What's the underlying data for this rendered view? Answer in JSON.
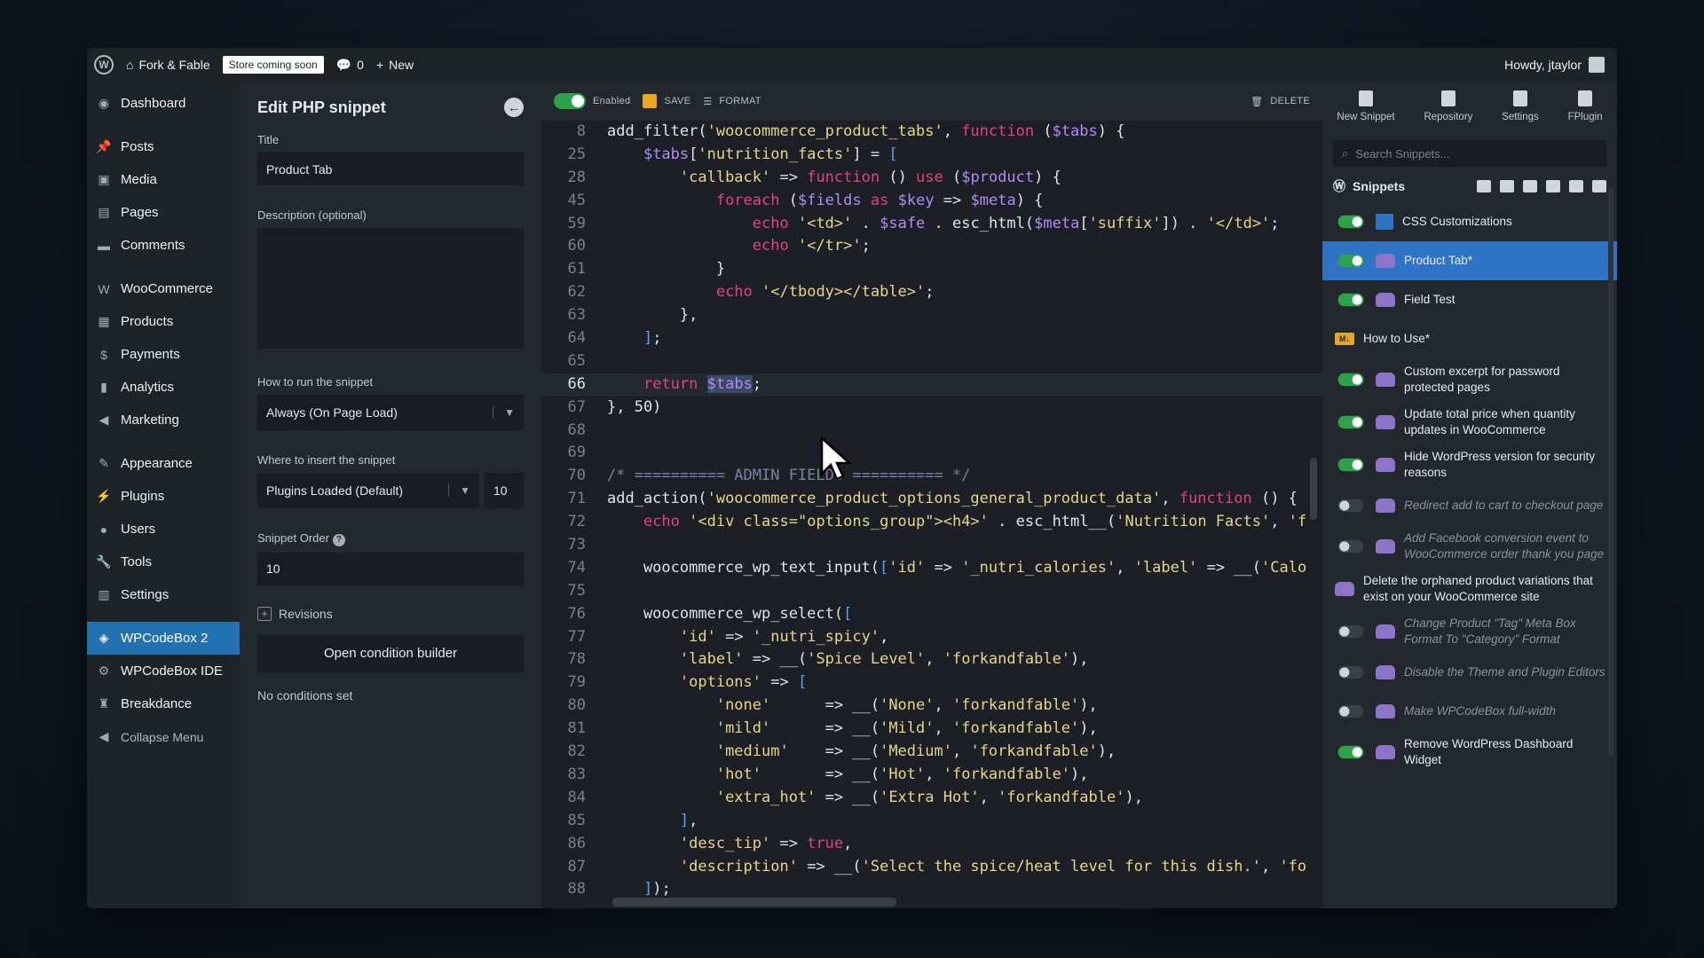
{
  "adminbar": {
    "site_name": "Fork & Fable",
    "store_badge": "Store coming soon",
    "comments_count": "0",
    "new_label": "New",
    "howdy": "Howdy, jtaylor"
  },
  "sidebar": {
    "items": [
      {
        "label": "Dashboard",
        "icon": "dashboard-icon"
      },
      {
        "label": "Posts",
        "icon": "pin-icon"
      },
      {
        "label": "Media",
        "icon": "media-icon"
      },
      {
        "label": "Pages",
        "icon": "pages-icon"
      },
      {
        "label": "Comments",
        "icon": "comment-icon"
      },
      {
        "label": "WooCommerce",
        "icon": "woo-icon"
      },
      {
        "label": "Products",
        "icon": "products-icon"
      },
      {
        "label": "Payments",
        "icon": "payments-icon"
      },
      {
        "label": "Analytics",
        "icon": "analytics-icon"
      },
      {
        "label": "Marketing",
        "icon": "megaphone-icon"
      },
      {
        "label": "Appearance",
        "icon": "brush-icon"
      },
      {
        "label": "Plugins",
        "icon": "plugin-icon"
      },
      {
        "label": "Users",
        "icon": "user-icon"
      },
      {
        "label": "Tools",
        "icon": "wrench-icon"
      },
      {
        "label": "Settings",
        "icon": "settings-icon"
      },
      {
        "label": "WPCodeBox 2",
        "icon": "codebox-icon"
      },
      {
        "label": "WPCodeBox IDE",
        "icon": "gear-icon"
      },
      {
        "label": "Breakdance",
        "icon": "breakdance-icon"
      }
    ],
    "collapse": "Collapse Menu"
  },
  "panel": {
    "title": "Edit PHP snippet",
    "title_label": "Title",
    "title_value": "Product Tab",
    "description_label": "Description (optional)",
    "run_label": "How to run the snippet",
    "run_value": "Always (On Page Load)",
    "insert_label": "Where to insert the snippet",
    "insert_value": "Plugins Loaded (Default)",
    "priority_value": "10",
    "order_label": "Snippet Order",
    "order_value": "10",
    "revisions": "Revisions",
    "condition_button": "Open condition builder",
    "no_conditions": "No conditions set"
  },
  "toolbar": {
    "enabled": "Enabled",
    "save": "SAVE",
    "format": "FORMAT",
    "delete": "DELETE"
  },
  "code_lines": [
    {
      "n": "8",
      "html": "add_filter(<span class='st'>'woocommerce_product_tabs'</span>, <span class='kw'>function</span> (<span class='vr'>$tabs</span>) {"
    },
    {
      "n": "25",
      "html": "    <span class='vr'>$tabs</span>[<span class='st'>'nutrition_facts'</span>] = <span class='br'>[</span>"
    },
    {
      "n": "28",
      "html": "        <span class='st'>'callback'</span> => <span class='kw'>function</span> () <span class='kw'>use</span> (<span class='vr'>$product</span>) {"
    },
    {
      "n": "45",
      "html": "            <span class='kw'>foreach</span> (<span class='vr'>$fields</span> <span class='kw'>as</span> <span class='vr'>$key</span> => <span class='vr'>$meta</span>) {"
    },
    {
      "n": "59",
      "html": "                <span class='kw'>echo</span> <span class='st'>'&lt;td&gt;'</span> . <span class='vr'>$safe</span> . esc_html(<span class='vr'>$meta</span>[<span class='st'>'suffix'</span>]) . <span class='st'>'&lt;/td&gt;'</span>;"
    },
    {
      "n": "60",
      "html": "                <span class='kw'>echo</span> <span class='st'>'&lt;/tr&gt;'</span>;"
    },
    {
      "n": "61",
      "html": "            }"
    },
    {
      "n": "62",
      "html": "            <span class='kw'>echo</span> <span class='st'>'&lt;/tbody&gt;&lt;/table&gt;'</span>;"
    },
    {
      "n": "63",
      "html": "        },"
    },
    {
      "n": "64",
      "html": "    <span class='br'>]</span>;"
    },
    {
      "n": "65",
      "html": ""
    },
    {
      "n": "66",
      "html": "    <span class='kw'>return</span> <span class='vr sel'>$tabs</span>;",
      "current": true
    },
    {
      "n": "67",
      "html": "}, 50)"
    },
    {
      "n": "68",
      "html": ""
    },
    {
      "n": "69",
      "html": ""
    },
    {
      "n": "70",
      "html": "<span class='cm'>/* ========== ADMIN FIELDS ========== */</span>"
    },
    {
      "n": "71",
      "html": "add_action(<span class='st'>'woocommerce_product_options_general_product_data'</span>, <span class='kw'>function</span> () {"
    },
    {
      "n": "72",
      "html": "    <span class='kw'>echo</span> <span class='st'>'&lt;div class=\"options_group\"&gt;&lt;h4&gt;'</span> . esc_html__(<span class='st'>'Nutrition Facts'</span>, <span class='st'>'f</span>"
    },
    {
      "n": "73",
      "html": ""
    },
    {
      "n": "74",
      "html": "    woocommerce_wp_text_input(<span class='br'>[</span><span class='st'>'id'</span> => <span class='st'>'_nutri_calories'</span>, <span class='st'>'label'</span> => __(<span class='st'>'Calo</span>"
    },
    {
      "n": "75",
      "html": ""
    },
    {
      "n": "76",
      "html": "    woocommerce_wp_select(<span class='br'>[</span>"
    },
    {
      "n": "77",
      "html": "        <span class='st'>'id'</span> => <span class='st'>'_nutri_spicy'</span>,"
    },
    {
      "n": "78",
      "html": "        <span class='st'>'label'</span> => __(<span class='st'>'Spice Level'</span>, <span class='st'>'forkandfable'</span>),"
    },
    {
      "n": "79",
      "html": "        <span class='st'>'options'</span> => <span class='br'>[</span>"
    },
    {
      "n": "80",
      "html": "            <span class='st'>'none'</span>      => __(<span class='st'>'None'</span>, <span class='st'>'forkandfable'</span>),"
    },
    {
      "n": "81",
      "html": "            <span class='st'>'mild'</span>      => __(<span class='st'>'Mild'</span>, <span class='st'>'forkandfable'</span>),"
    },
    {
      "n": "82",
      "html": "            <span class='st'>'medium'</span>    => __(<span class='st'>'Medium'</span>, <span class='st'>'forkandfable'</span>),"
    },
    {
      "n": "83",
      "html": "            <span class='st'>'hot'</span>       => __(<span class='st'>'Hot'</span>, <span class='st'>'forkandfable'</span>),"
    },
    {
      "n": "84",
      "html": "            <span class='st'>'extra_hot'</span> => __(<span class='st'>'Extra Hot'</span>, <span class='st'>'forkandfable'</span>),"
    },
    {
      "n": "85",
      "html": "        <span class='br'>]</span>,"
    },
    {
      "n": "86",
      "html": "        <span class='st'>'desc_tip'</span> => <span class='kw'>true</span>,"
    },
    {
      "n": "87",
      "html": "        <span class='st'>'description'</span> => __(<span class='st'>'Select the spice/heat level for this dish.'</span>, <span class='st'>'fo</span>"
    },
    {
      "n": "88",
      "html": "    <span class='br'>]</span>);"
    }
  ],
  "right": {
    "tabs": [
      "New Snippet",
      "Repository",
      "Settings",
      "FPlugin"
    ],
    "search_placeholder": "Search Snippets...",
    "snippets_title": "Snippets",
    "snippets": [
      {
        "label": "CSS Customizations",
        "toggle": "on",
        "icon": "css-icon"
      },
      {
        "label": "Product Tab*",
        "toggle": "on",
        "icon": "php-icon",
        "active": true
      },
      {
        "label": "Field Test",
        "toggle": "on",
        "icon": "php-icon"
      },
      {
        "label": "How to Use*",
        "toggle": "none",
        "icon": "markdown-icon"
      },
      {
        "label": "Custom excerpt for password protected pages",
        "toggle": "on",
        "icon": "php-icon"
      },
      {
        "label": "Update total price when quantity updates in WooCommerce",
        "toggle": "on",
        "icon": "php-icon"
      },
      {
        "label": "Hide WordPress version for security reasons",
        "toggle": "on",
        "icon": "php-icon"
      },
      {
        "label": "Redirect add to cart to checkout page",
        "toggle": "off",
        "icon": "php-icon"
      },
      {
        "label": "Add Facebook conversion event to WooCommerce order thank you page",
        "toggle": "off",
        "icon": "php-icon"
      },
      {
        "label": "Delete the orphaned product variations that exist on your WooCommerce site",
        "toggle": "none",
        "icon": "php-icon"
      },
      {
        "label": "Change Product \"Tag\" Meta Box Format To \"Category\" Format",
        "toggle": "off",
        "icon": "php-icon"
      },
      {
        "label": "Disable the Theme and Plugin Editors",
        "toggle": "off",
        "icon": "php-icon"
      },
      {
        "label": "Make WPCodeBox full-width",
        "toggle": "off",
        "icon": "php-icon"
      },
      {
        "label": "Remove WordPress Dashboard Widget",
        "toggle": "on",
        "icon": "php-icon"
      }
    ]
  }
}
